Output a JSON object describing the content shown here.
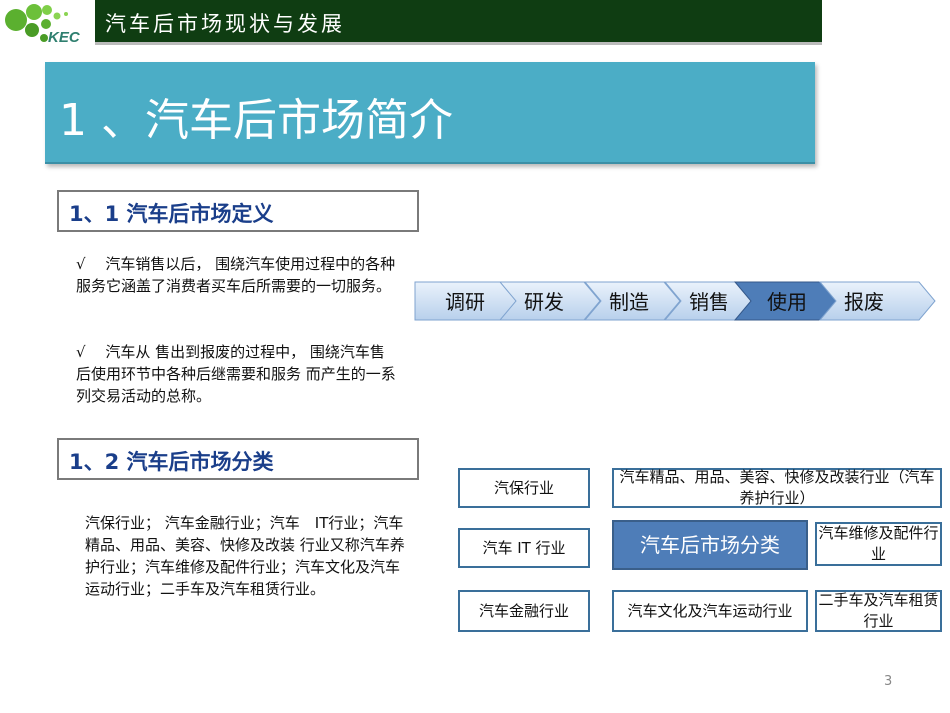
{
  "header": {
    "title": "汽车后市场现状与发展",
    "logo_text": "KEC"
  },
  "banner": {
    "title": "1 、汽车后市场简介"
  },
  "section1": {
    "title": "1、1 汽车后市场定义",
    "p1": "√　 汽车销售以后， 围绕汽车使用过程中的各种 服务它涵盖了消费者买车后所需要的一切服务。",
    "p2": "√　 汽车从 售出到报废的过程中， 围绕汽车售后使用环节中各种后继需要和服务 而产生的一系列交易活动的总称。"
  },
  "process": {
    "steps": [
      "调研",
      "研发",
      "制造",
      "销售",
      "使用",
      "报废"
    ],
    "active_index": 4
  },
  "section2": {
    "title": "1、2 汽车后市场分类",
    "p": "汽保行业； 汽车金融行业；汽车　IT行业；汽车精品、用品、美容、快修及改装 行业又称汽车养护行业；汽车维修及配件行业；汽车文化及汽车运动行业；二手车及汽车租赁行业。"
  },
  "classification": {
    "center": "汽车后市场分类",
    "boxes": [
      "汽保行业",
      "汽车精品、用品、美容、快修及改装行业（汽车养护行业）",
      "汽车 IT 行业",
      "汽车维修及配件行业",
      "汽车金融行业",
      "汽车文化及汽车运动行业",
      "二手车及汽车租赁行业"
    ]
  },
  "page_number": "3",
  "colors": {
    "header": "#0f3d12",
    "banner": "#4badc6",
    "active": "#4e7db8"
  }
}
